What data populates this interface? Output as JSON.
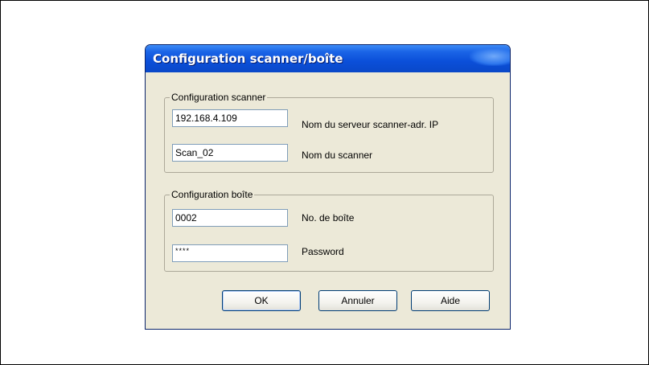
{
  "dialog": {
    "title": "Configuration scanner/boîte",
    "scanner_group": {
      "legend": "Configuration scanner",
      "server_field": {
        "value": "192.168.4.109",
        "label": "Nom du serveur scanner-adr. IP"
      },
      "scanner_field": {
        "value": "Scan_02",
        "label": "Nom du scanner"
      }
    },
    "box_group": {
      "legend": "Configuration boîte",
      "box_number_field": {
        "value": "0002",
        "label": "No. de boîte"
      },
      "password_field": {
        "value": "****",
        "label": "Password"
      }
    },
    "buttons": {
      "ok": "OK",
      "cancel": "Annuler",
      "help": "Aide"
    }
  },
  "colors": {
    "titlebar": "#0b4fd9",
    "dialog_bg": "#ece9d8",
    "field_border": "#7f9db9"
  }
}
